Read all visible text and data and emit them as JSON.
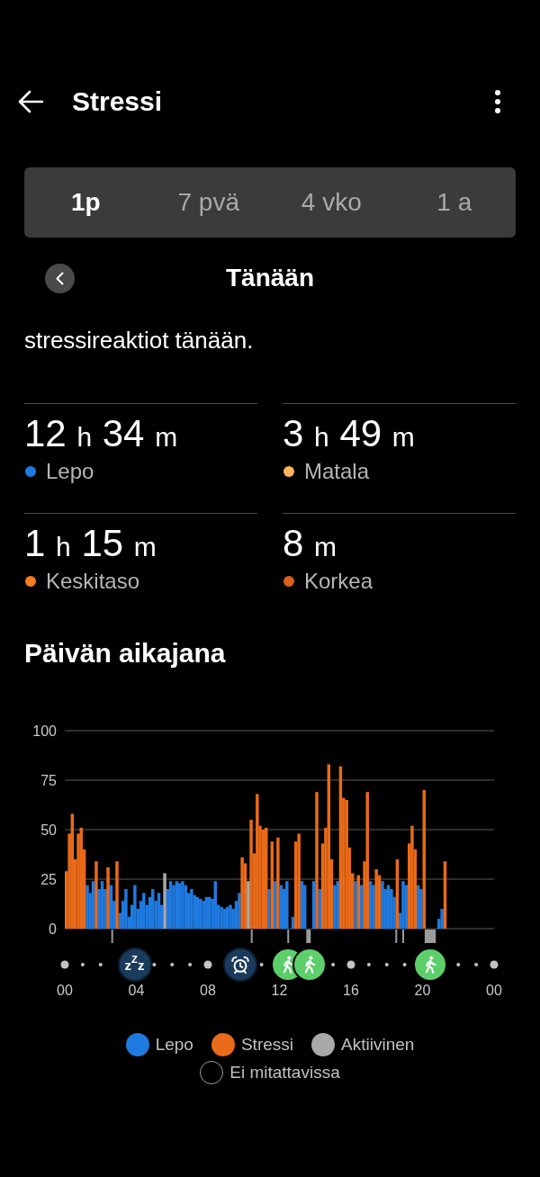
{
  "header": {
    "title": "Stressi"
  },
  "tabs": [
    {
      "label": "1p",
      "selected": true
    },
    {
      "label": "7 pvä",
      "selected": false
    },
    {
      "label": "4 vko",
      "selected": false
    },
    {
      "label": "1 a",
      "selected": false
    }
  ],
  "date_nav": {
    "label": "Tänään"
  },
  "summary": "stressireaktiot tänään.",
  "stats": [
    {
      "value": "12 h 34 m",
      "label": "Lepo",
      "color": "#1f7ae0"
    },
    {
      "value": "3 h 49 m",
      "label": "Matala",
      "color": "#ffb45c"
    },
    {
      "value": "1 h 15 m",
      "label": "Keskitaso",
      "color": "#f47d20"
    },
    {
      "value": "8 m",
      "label": "Korkea",
      "color": "#d9601a"
    }
  ],
  "timeline": {
    "title": "Päivän aikajana",
    "chart_data": {
      "type": "bar",
      "grid": true,
      "xlim": [
        0,
        24
      ],
      "ylim": [
        0,
        100
      ],
      "xticks": [
        {
          "value": 0,
          "label": "00"
        },
        {
          "value": 4,
          "label": "04"
        },
        {
          "value": 8,
          "label": "08"
        },
        {
          "value": 12,
          "label": "12"
        },
        {
          "value": 16,
          "label": "16"
        },
        {
          "value": 20,
          "label": "20"
        },
        {
          "value": 24,
          "label": "00"
        }
      ],
      "yticks": [
        0,
        25,
        50,
        75,
        100
      ],
      "x": [
        0,
        0.17,
        0.33,
        0.5,
        0.67,
        0.83,
        1,
        1.17,
        1.33,
        1.5,
        1.67,
        1.83,
        2,
        2.17,
        2.33,
        2.5,
        2.67,
        2.83,
        3,
        3.17,
        3.33,
        3.5,
        3.67,
        3.83,
        4,
        4.17,
        4.33,
        4.5,
        4.67,
        4.83,
        5,
        5.17,
        5.33,
        5.5,
        5.67,
        5.83,
        6,
        6.17,
        6.33,
        6.5,
        6.67,
        6.83,
        7,
        7.17,
        7.33,
        7.5,
        7.67,
        7.83,
        8,
        8.17,
        8.33,
        8.5,
        8.67,
        8.83,
        9,
        9.17,
        9.33,
        9.5,
        9.67,
        9.83,
        10,
        10.17,
        10.33,
        10.5,
        10.67,
        10.83,
        11,
        11.17,
        11.33,
        11.5,
        11.67,
        11.83,
        12,
        12.17,
        12.33,
        12.67,
        12.83,
        13,
        13.17,
        13.33,
        13.83,
        14,
        14.17,
        14.33,
        14.5,
        14.67,
        14.83,
        15,
        15.17,
        15.33,
        15.5,
        15.67,
        15.83,
        16,
        16.17,
        16.33,
        16.5,
        16.67,
        16.83,
        17,
        17.17,
        17.33,
        17.5,
        17.67,
        17.83,
        18,
        18.17,
        18.33,
        18.5,
        18.67,
        18.83,
        19,
        19.17,
        19.33,
        19.5,
        19.67,
        19.83,
        20,
        20.83,
        21,
        21.17
      ],
      "series": [
        {
          "name": "Lepo",
          "color": "#1f7ae0",
          "values": [
            null,
            null,
            null,
            null,
            null,
            null,
            null,
            22,
            18,
            24,
            null,
            20,
            24,
            20,
            null,
            22,
            14,
            null,
            8,
            14,
            20,
            6,
            12,
            22,
            10,
            14,
            18,
            12,
            16,
            20,
            14,
            18,
            12,
            null,
            20,
            24,
            22,
            24,
            23,
            24,
            22,
            18,
            20,
            17,
            16,
            15,
            14,
            16,
            16,
            15,
            24,
            12,
            11,
            10,
            11,
            12,
            10,
            14,
            18,
            null,
            null,
            null,
            null,
            null,
            null,
            null,
            null,
            null,
            20,
            null,
            24,
            null,
            22,
            20,
            24,
            6,
            null,
            null,
            24,
            22,
            24,
            null,
            20,
            null,
            null,
            null,
            null,
            22,
            24,
            null,
            null,
            null,
            null,
            null,
            24,
            null,
            22,
            null,
            null,
            24,
            22,
            null,
            null,
            24,
            20,
            22,
            20,
            16,
            null,
            8,
            24,
            22,
            null,
            null,
            null,
            22,
            20,
            null,
            5,
            10,
            null
          ]
        },
        {
          "name": "Stressi",
          "color": "#e96a19",
          "values": [
            29,
            48,
            58,
            35,
            48,
            51,
            40,
            null,
            null,
            null,
            34,
            null,
            null,
            null,
            31,
            null,
            null,
            34,
            null,
            null,
            null,
            null,
            null,
            null,
            null,
            null,
            null,
            null,
            null,
            null,
            null,
            null,
            null,
            null,
            null,
            null,
            null,
            null,
            null,
            null,
            null,
            null,
            null,
            null,
            null,
            null,
            null,
            null,
            null,
            null,
            null,
            null,
            null,
            null,
            null,
            null,
            null,
            null,
            null,
            36,
            33,
            null,
            55,
            38,
            68,
            52,
            50,
            51,
            null,
            44,
            null,
            46,
            null,
            null,
            null,
            null,
            44,
            48,
            null,
            null,
            null,
            69,
            null,
            43,
            51,
            83,
            35,
            null,
            null,
            82,
            66,
            65,
            41,
            28,
            null,
            27,
            null,
            34,
            69,
            null,
            null,
            30,
            27,
            null,
            null,
            null,
            null,
            null,
            35,
            null,
            null,
            null,
            43,
            52,
            40,
            null,
            null,
            70,
            null,
            null,
            34
          ]
        },
        {
          "name": "Aktiivinen",
          "color": "#a9a9a9",
          "values": [
            null,
            null,
            null,
            null,
            null,
            null,
            null,
            null,
            null,
            null,
            null,
            null,
            null,
            null,
            null,
            null,
            null,
            null,
            null,
            null,
            null,
            null,
            null,
            null,
            null,
            null,
            null,
            null,
            null,
            null,
            null,
            null,
            null,
            28,
            null,
            null,
            null,
            null,
            null,
            null,
            null,
            null,
            null,
            null,
            null,
            null,
            null,
            null,
            null,
            null,
            null,
            null,
            null,
            null,
            null,
            null,
            null,
            null,
            null,
            null,
            null,
            24,
            null,
            null,
            null,
            null,
            null,
            null,
            null,
            null,
            null,
            null,
            null,
            null,
            null,
            null,
            null,
            null,
            null,
            null,
            null,
            null,
            null,
            null,
            null,
            null,
            null,
            null,
            null,
            null,
            null,
            null,
            null,
            null,
            null,
            null,
            null,
            null,
            null,
            null,
            null,
            null,
            null,
            null,
            null,
            null,
            null,
            null,
            null,
            null,
            null,
            null,
            null,
            null,
            null,
            null,
            null,
            null,
            null,
            null,
            null
          ]
        }
      ]
    },
    "events": [
      {
        "kind": "sleep",
        "label": "z$^{Z}$z"
      },
      {
        "kind": "alarm"
      },
      {
        "kind": "walk"
      },
      {
        "kind": "walk"
      },
      {
        "kind": "walk"
      }
    ],
    "legend": [
      {
        "label": "Ei mitattavissa",
        "color": "#9e9e9e",
        "kind": "outline"
      }
    ]
  }
}
